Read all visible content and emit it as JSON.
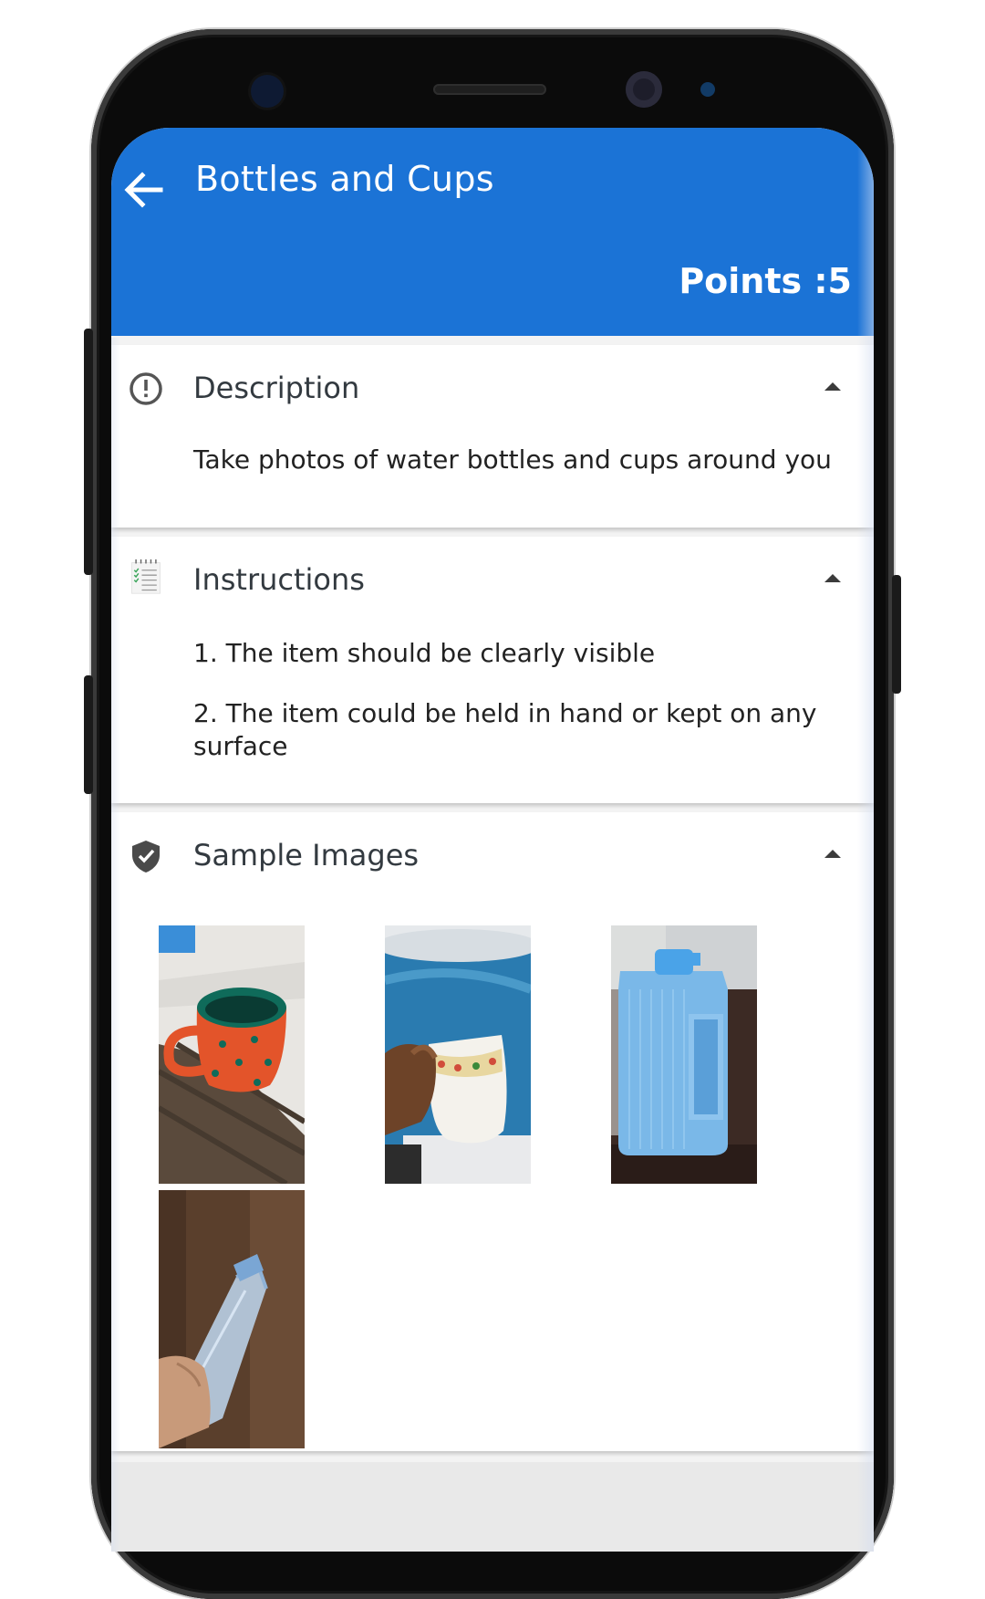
{
  "header": {
    "title": "Bottles and Cups",
    "points": "Points :5"
  },
  "sections": [
    {
      "title": "Description",
      "icon": "info-circle-icon",
      "lines": [
        "Take photos of water bottles and cups around you"
      ]
    },
    {
      "title": "Instructions",
      "icon": "notepad-checklist-icon",
      "lines": [
        "1. The item should be clearly visible",
        "2. The item could be held in hand or kept on any surface"
      ]
    },
    {
      "title": "Sample Images",
      "icon": "shield-check-icon",
      "images": [
        "orange-mug-photo",
        "white-cup-blue-dispenser-photo",
        "blue-plastic-jug-photo",
        "plastic-bottle-in-hand-photo"
      ]
    }
  ],
  "colors": {
    "appbar": "#1b73d6",
    "background": "#f3f3f3",
    "card": "#ffffff"
  }
}
